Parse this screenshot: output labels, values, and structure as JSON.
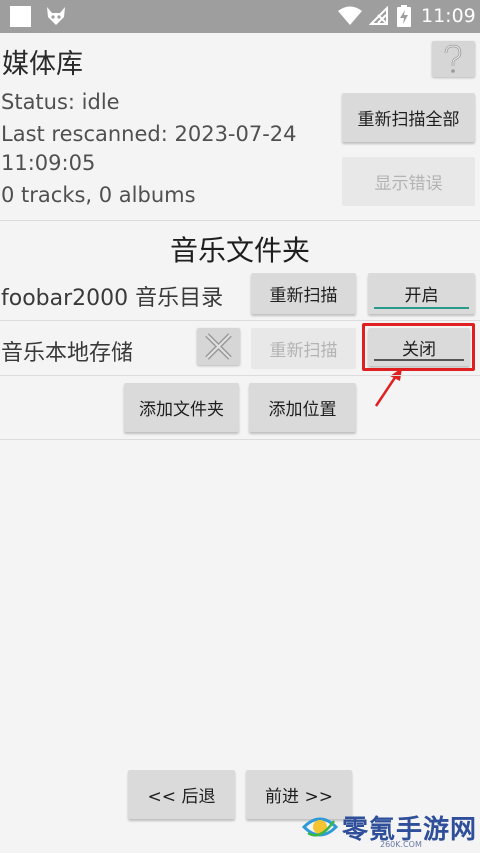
{
  "status_bar": {
    "time": "11:09",
    "icons": [
      "square-icon",
      "fox-app-icon",
      "wifi-icon",
      "no-signal-icon",
      "battery-charging-icon"
    ]
  },
  "header": {
    "title": "媒体库",
    "help_icon": "question-mark-icon"
  },
  "status": {
    "status_text": "Status: idle",
    "last_rescanned_line1": "Last rescanned: 2023-07-24",
    "last_rescanned_line2": "11:09:05",
    "counts": "0 tracks, 0 albums"
  },
  "buttons": {
    "rescan_all": "重新扫描全部",
    "show_errors": "显示错误"
  },
  "folders": {
    "section_title": "音乐文件夹",
    "items": [
      {
        "label": "foobar2000 音乐目录",
        "rescan_label": "重新扫描",
        "toggle_label": "开启",
        "rescan_enabled": true
      },
      {
        "label": "音乐本地存储",
        "remove_icon": "close-x-icon",
        "rescan_label": "重新扫描",
        "toggle_label": "关闭",
        "rescan_enabled": false
      }
    ],
    "add_folder": "添加文件夹",
    "add_location": "添加位置"
  },
  "nav": {
    "back": "<< 后退",
    "forward": "前进 >>"
  },
  "annotation": {
    "highlight_color": "#e02020",
    "arrow_icon": "red-arrow-icon"
  },
  "watermark": {
    "text": "零氪手游网",
    "sub": "260K.COM"
  },
  "colors": {
    "toggle_on_underline": "#2a9a8a",
    "toggle_off_underline": "#555555",
    "status_bar": "#9e9e9e",
    "background": "#f4f4f4"
  }
}
